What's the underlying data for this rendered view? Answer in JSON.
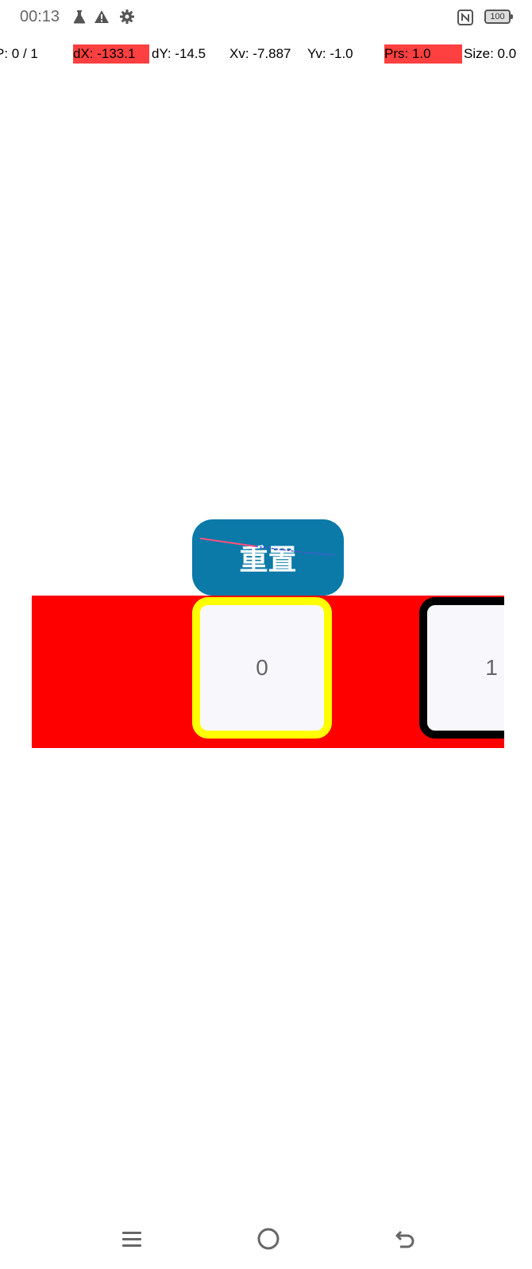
{
  "status_bar": {
    "time": "00:13",
    "battery": "100",
    "icons": [
      "flask-icon",
      "warning-icon",
      "gear-icon",
      "nfc-icon",
      "battery-icon"
    ]
  },
  "pointer_info": {
    "pointers": "P: 0 / 1",
    "dx": "dX: -133.1",
    "dy": "dY: -14.5",
    "xv": "Xv: -7.887",
    "yv": "Yv: -1.0",
    "prs": "Prs: 1.0",
    "size": "Size: 0.0"
  },
  "reset_button": {
    "label": "重置"
  },
  "strip": {
    "cards": [
      {
        "label": "0"
      },
      {
        "label": "1"
      }
    ],
    "colors": {
      "background": "#ff0000",
      "selected_border": "#ffff00",
      "default_border": "#000000"
    }
  },
  "nav_bar": {
    "icons": [
      "menu-icon",
      "home-icon",
      "back-icon"
    ]
  }
}
